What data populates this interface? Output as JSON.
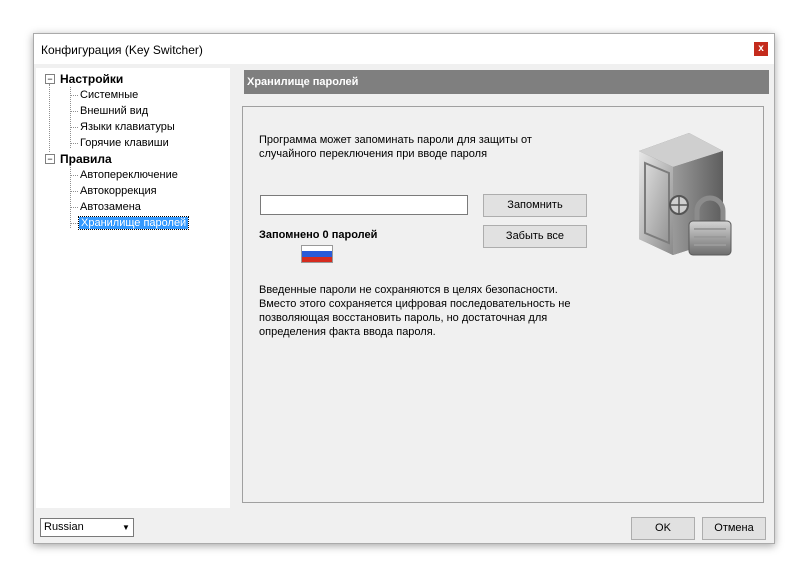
{
  "window": {
    "title": "Конфигурация (Key Switcher)",
    "close_glyph": "x"
  },
  "tree": {
    "roots": [
      {
        "label": "Настройки",
        "expander": "−",
        "children": [
          "Системные",
          "Внешний вид",
          "Языки клавиатуры",
          "Горячие клавиши"
        ]
      },
      {
        "label": "Правила",
        "expander": "−",
        "children": [
          "Автопереключение",
          "Автокоррекция",
          "Автозамена",
          "Хранилище паролей"
        ]
      }
    ],
    "selected": "Хранилище паролей"
  },
  "panel": {
    "header": "Хранилище паролей",
    "intro_line1": "Программа может запоминать пароли для защиты от",
    "intro_line2": "случайного переключения при вводе пароля",
    "password_value": "",
    "remember_button": "Запомнить",
    "forget_all_button": "Забыть все",
    "saved_count": "Запомнено 0 паролей",
    "note_line1": "Введенные пароли не сохраняются в целях безопасности.",
    "note_line2": "Вместо этого сохраняется цифровая последовательность не",
    "note_line3": "позволяющая восстановить пароль, но достаточная для",
    "note_line4": "определения факта ввода пароля.",
    "flag_icon": "russian-flag-icon",
    "safe_icon": "safe-with-padlock-icon"
  },
  "footer": {
    "language": "Russian",
    "ok_button": "OK",
    "cancel_button": "Отмена"
  },
  "colors": {
    "header_bg": "#7f7f7f",
    "selection": "#3399ff",
    "close_button": "#c42b1c"
  }
}
